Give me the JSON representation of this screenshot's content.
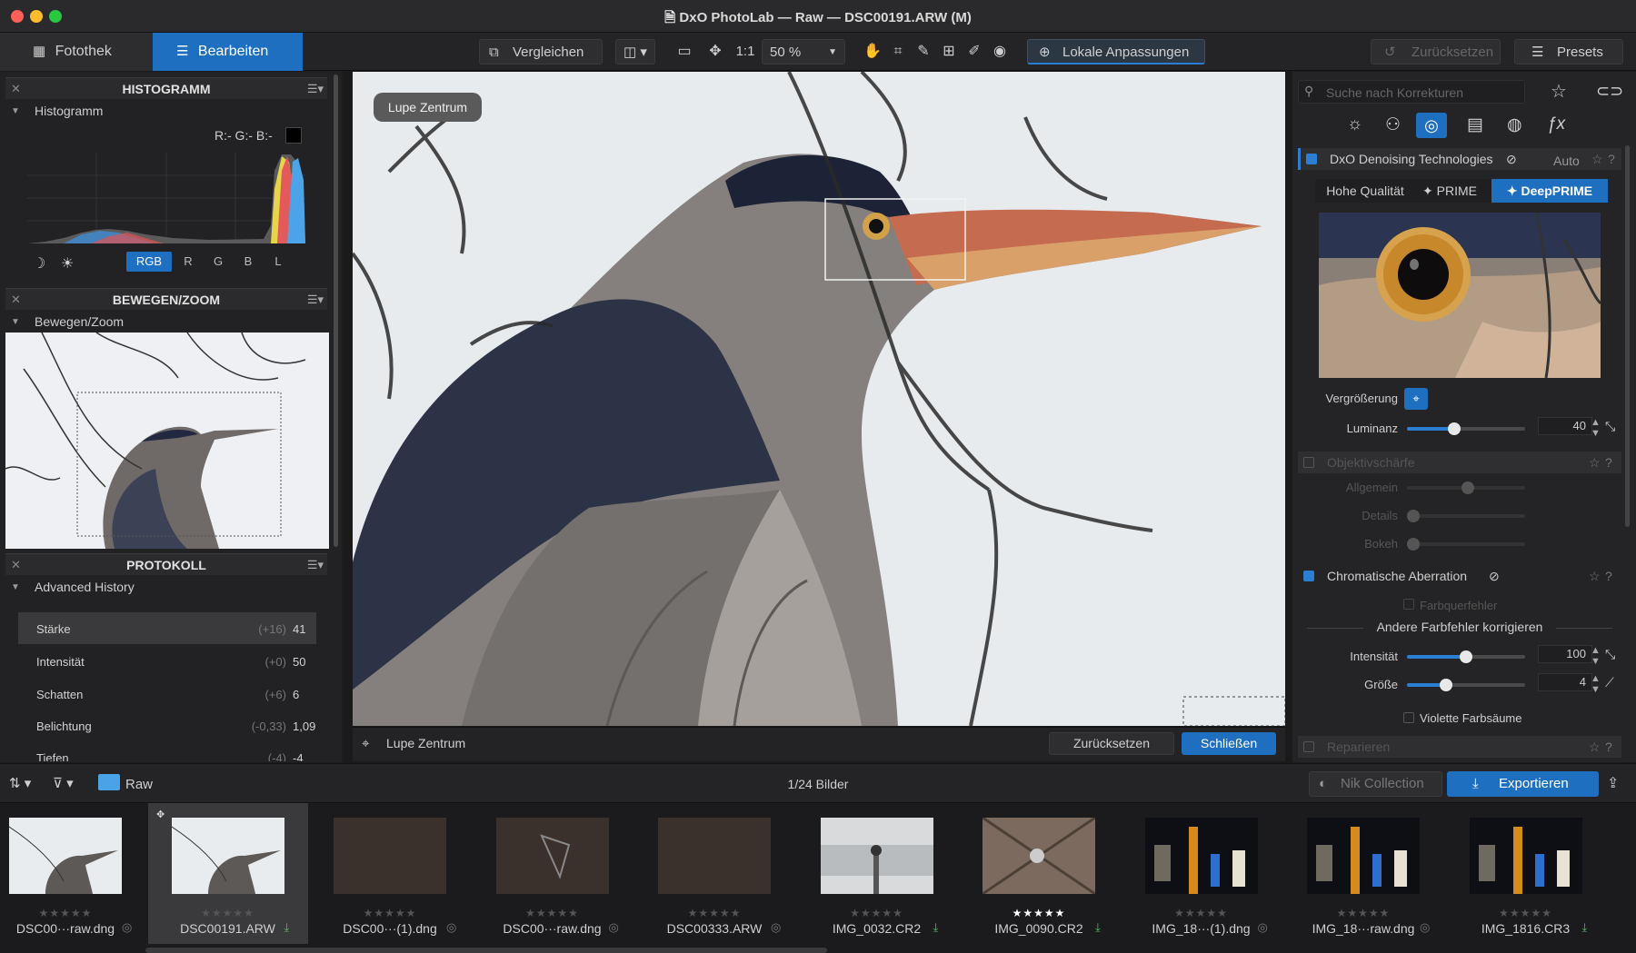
{
  "window": {
    "title": "DxO PhotoLab — Raw — DSC00191.ARW (M)"
  },
  "tabs": {
    "library": "Fotothek",
    "edit": "Bearbeiten"
  },
  "toolbar": {
    "compare": "Vergleichen",
    "one_to_one": "1:1",
    "zoom": "50 %",
    "local_adjustments": "Lokale Anpassungen",
    "reset": "Zurücksetzen",
    "presets": "Presets"
  },
  "histogram": {
    "header": "HISTOGRAMM",
    "sub": "Histogramm",
    "rgb_readout": "R:- G:- B:-",
    "channels": [
      "RGB",
      "R",
      "G",
      "B",
      "L"
    ]
  },
  "move_zoom": {
    "header": "BEWEGEN/ZOOM",
    "sub": "Bewegen/Zoom"
  },
  "protocol": {
    "header": "PROTOKOLL",
    "sub": "Advanced History",
    "rows": [
      {
        "name": "Stärke",
        "delta": "(+16)",
        "value": "41"
      },
      {
        "name": "Intensität",
        "delta": "(+0)",
        "value": "50"
      },
      {
        "name": "Schatten",
        "delta": "(+6)",
        "value": "6"
      },
      {
        "name": "Belichtung",
        "delta": "(-0,33)",
        "value": "1,09"
      },
      {
        "name": "Tiefen",
        "delta": "(-4)",
        "value": "-4"
      }
    ]
  },
  "viewer": {
    "loupe_tag": "Lupe Zentrum",
    "loupe_label": "Lupe Zentrum",
    "reset": "Zurücksetzen",
    "close": "Schließen"
  },
  "corrections": {
    "search_placeholder": "Suche nach Korrekturen",
    "denoise": {
      "title": "DxO Denoising Technologies",
      "auto": "Auto",
      "modes": [
        "Hohe Qualität",
        "PRIME",
        "DeepPRIME"
      ],
      "magnification": "Vergrößerung",
      "luminance_label": "Luminanz",
      "luminance": "40",
      "luminance_level": 0.4
    },
    "sharpness": {
      "title": "Objektivschärfe",
      "general": "Allgemein",
      "details": "Details",
      "bokeh": "Bokeh"
    },
    "chroma": {
      "title": "Chromatische Aberration",
      "lateral": "Farbquerfehler",
      "other_title": "Andere Farbfehler korrigieren",
      "intensity_label": "Intensität",
      "intensity": "100",
      "intensity_level": 0.5,
      "size_label": "Größe",
      "size": "4",
      "size_level": 0.33,
      "purple_fringe": "Violette Farbsäume"
    },
    "repair": {
      "title": "Reparieren"
    }
  },
  "filmstrip": {
    "folder": "Raw",
    "count": "1/24 Bilder",
    "nik": "Nik Collection",
    "export": "Exportieren",
    "items": [
      {
        "name": "DSC00···raw.dng",
        "stars": "★★★★★"
      },
      {
        "name": "DSC00191.ARW",
        "stars": "★★★★★"
      },
      {
        "name": "DSC00···(1).dng",
        "stars": "★★★★★"
      },
      {
        "name": "DSC00···raw.dng",
        "stars": "★★★★★"
      },
      {
        "name": "DSC00333.ARW",
        "stars": "★★★★★"
      },
      {
        "name": "IMG_0032.CR2",
        "stars": "★★★★★"
      },
      {
        "name": "IMG_0090.CR2",
        "stars": "★★★★★"
      },
      {
        "name": "IMG_18···(1).dng",
        "stars": "★★★★★"
      },
      {
        "name": "IMG_18···raw.dng",
        "stars": "★★★★★"
      },
      {
        "name": "IMG_1816.CR3",
        "stars": "★★★★★"
      }
    ]
  }
}
